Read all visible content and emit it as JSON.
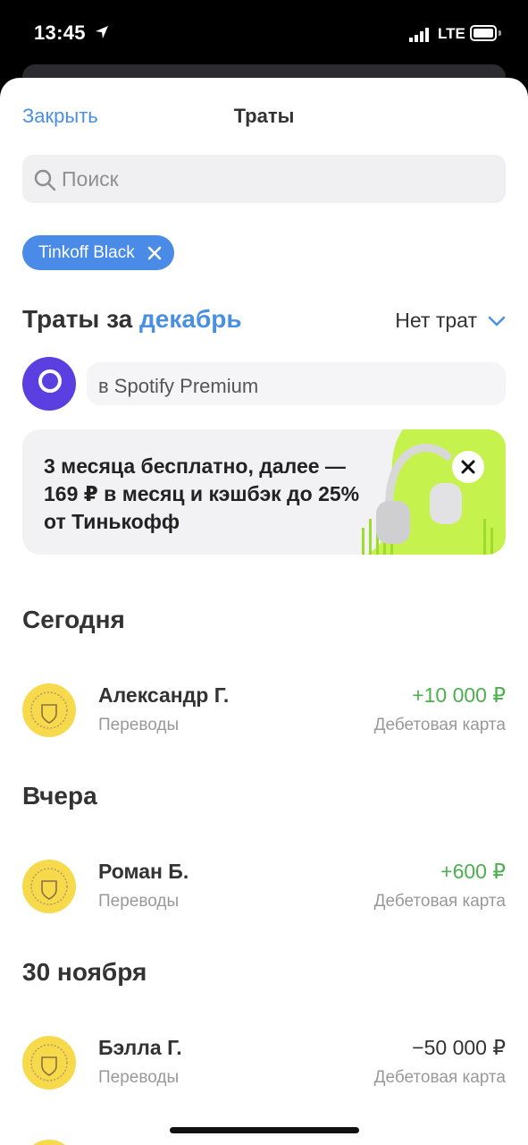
{
  "status_bar": {
    "time": "13:45",
    "network": "LTE"
  },
  "header": {
    "close_label": "Закрыть",
    "title": "Траты"
  },
  "search": {
    "placeholder": "Поиск"
  },
  "filter_chip": {
    "label": "Tinkoff Black"
  },
  "section": {
    "title_prefix": "Траты за",
    "month": "декабрь",
    "filter_label": "Нет трат"
  },
  "story": {
    "text": "в Spotify Premium"
  },
  "promo": {
    "line1": "3 месяца бесплатно, далее —",
    "line2": "169 ₽ в месяц и кэшбэк до 25%",
    "line3": "от Тинькофф",
    "accent_color": "#c6f24e"
  },
  "groups": [
    {
      "title": "Сегодня",
      "items": [
        {
          "name": "Александр Г.",
          "category": "Переводы",
          "amount": "+10 000 ₽",
          "source": "Дебетовая карта",
          "income": true
        }
      ]
    },
    {
      "title": "Вчера",
      "items": [
        {
          "name": "Роман Б.",
          "category": "Переводы",
          "amount": "+600 ₽",
          "source": "Дебетовая карта",
          "income": true
        }
      ]
    },
    {
      "title": "30 ноября",
      "items": [
        {
          "name": "Бэлла Г.",
          "category": "Переводы",
          "amount": "−50 000 ₽",
          "source": "Дебетовая карта",
          "income": false
        }
      ]
    }
  ],
  "colors": {
    "link": "#4a90e2",
    "chip": "#4a8be8",
    "income": "#4caf50",
    "logo_bg": "#f7d94c"
  }
}
